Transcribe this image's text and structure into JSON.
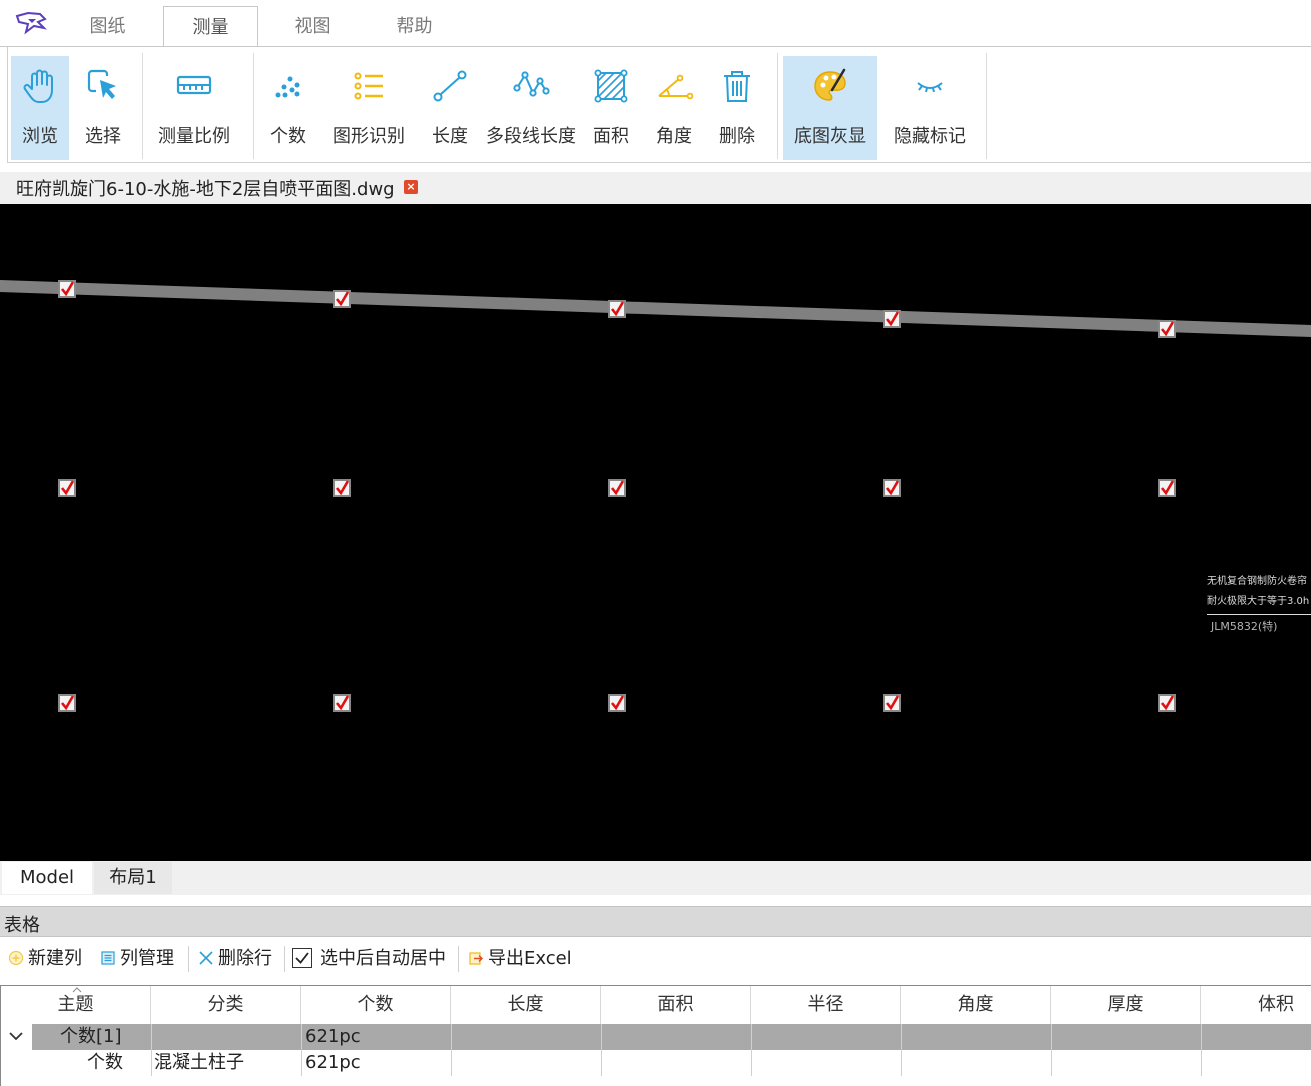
{
  "menu": {
    "tabs": [
      {
        "label": "图纸",
        "active": false
      },
      {
        "label": "测量",
        "active": true
      },
      {
        "label": "视图",
        "active": false
      },
      {
        "label": "帮助",
        "active": false
      }
    ]
  },
  "ribbon": {
    "browse": "浏览",
    "select": "选择",
    "scale": "测量比例",
    "count": "个数",
    "shape_recognition": "图形识别",
    "length": "长度",
    "polyline_length": "多段线长度",
    "area": "面积",
    "angle": "角度",
    "delete": "删除",
    "gray_base": "底图灰显",
    "hide_marks": "隐藏标记"
  },
  "document": {
    "title": "旺府凯旋门6-10-水施-地下2层自喷平面图.dwg"
  },
  "canvas": {
    "note_line1": "无机复合钢制防火卷帘",
    "note_line2": "耐火极限大于等于3.0h",
    "note_line3": "JLM5832(特)"
  },
  "layout_tabs": [
    "Model",
    "布局1"
  ],
  "table_panel": {
    "title": "表格",
    "toolbar": {
      "new_column": "新建列",
      "column_manage": "列管理",
      "delete_row": "删除行",
      "auto_center": "选中后自动居中",
      "auto_center_checked": true,
      "export_excel": "导出Excel"
    },
    "columns": [
      "主题",
      "分类",
      "个数",
      "长度",
      "面积",
      "半径",
      "角度",
      "厚度",
      "体积"
    ],
    "group_row": {
      "subject": "个数[1]",
      "count": "621pc"
    },
    "rows": [
      {
        "subject": "个数",
        "category": "混凝土柱子",
        "count": "621pc"
      }
    ]
  },
  "colors": {
    "accent_icon": "#2a9fd8",
    "yellow_icon": "#f2b90f",
    "highlight_bg": "#cde6f7",
    "marker_red": "#e01010"
  }
}
